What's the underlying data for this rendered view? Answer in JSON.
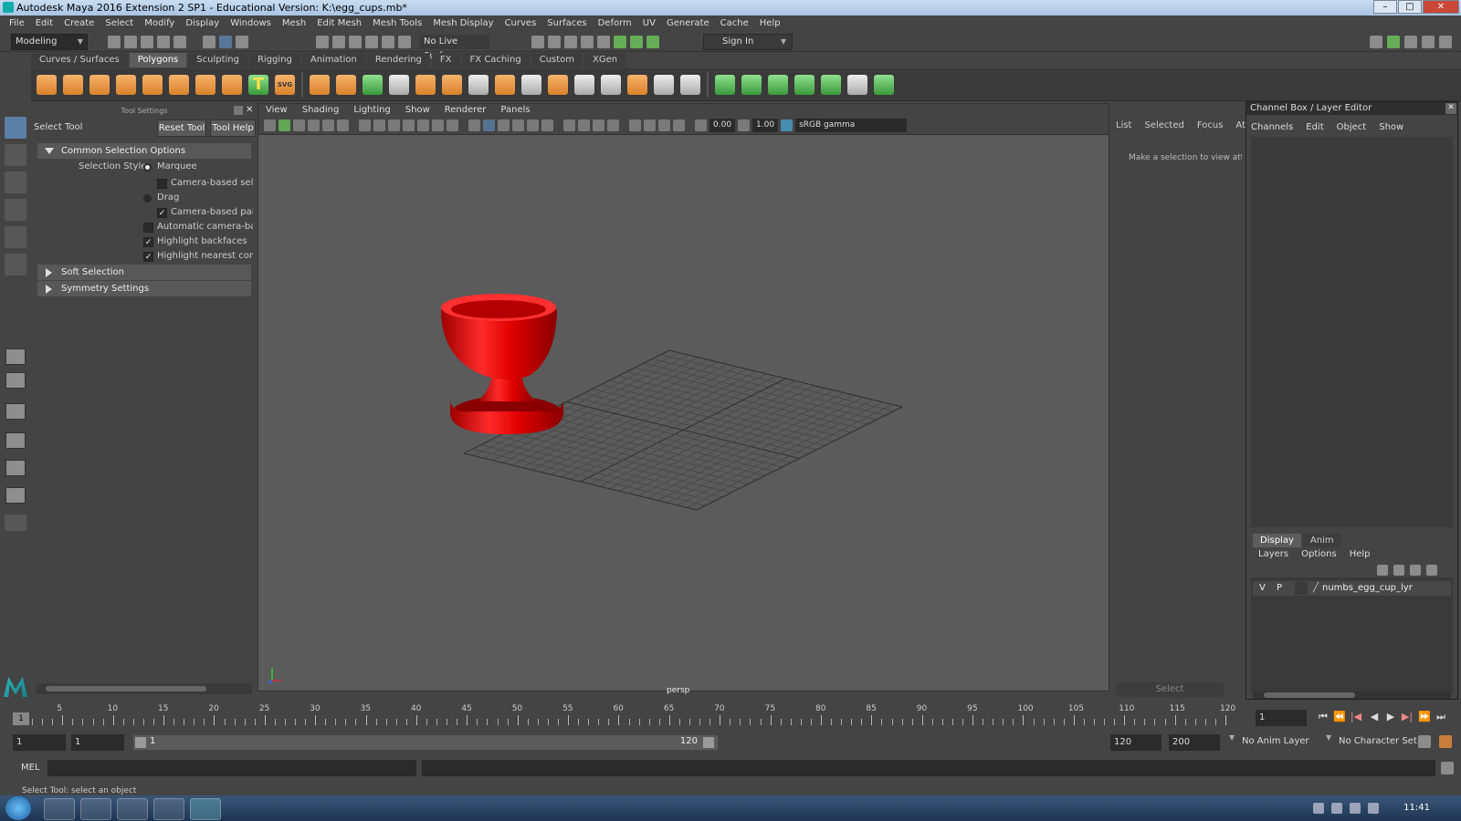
{
  "window": {
    "title": "Autodesk Maya 2016 Extension 2 SP1 - Educational Version: K:\\egg_cups.mb*",
    "min": "–",
    "max": "□",
    "close": "✕"
  },
  "menubar": [
    "File",
    "Edit",
    "Create",
    "Select",
    "Modify",
    "Display",
    "Windows",
    "Mesh",
    "Edit Mesh",
    "Mesh Tools",
    "Mesh Display",
    "Curves",
    "Surfaces",
    "Deform",
    "UV",
    "Generate",
    "Cache",
    "Help"
  ],
  "statusline": {
    "mode": "Modeling",
    "live_surface": "No Live Surface",
    "sign_in": "Sign In"
  },
  "shelf": {
    "tabs": [
      "Curves / Surfaces",
      "Polygons",
      "Sculpting",
      "Rigging",
      "Animation",
      "Rendering",
      "FX",
      "FX Caching",
      "Custom",
      "XGen"
    ],
    "active": "Polygons",
    "text_tool": "T",
    "svg_tool": "SVG"
  },
  "tool_settings": {
    "panel_title": "Tool Settings",
    "tool_name": "Select Tool",
    "reset_tool": "Reset Tool",
    "tool_help": "Tool Help",
    "section_common": "Common Selection Options",
    "selection_style_label": "Selection Style:",
    "marquee": "Marquee",
    "camera_based_selection": "Camera-based selecti",
    "drag": "Drag",
    "camera_based_paint": "Camera-based paint :",
    "automatic_camera_based": "Automatic camera-based",
    "highlight_backfaces": "Highlight backfaces",
    "highlight_nearest": "Highlight nearest compo",
    "section_soft": "Soft Selection",
    "section_symmetry": "Symmetry Settings"
  },
  "viewport": {
    "menus": [
      "View",
      "Shading",
      "Lighting",
      "Show",
      "Renderer",
      "Panels"
    ],
    "exposure": "0.00",
    "gamma": "1.00",
    "color_space": "sRGB gamma",
    "camera_label": "persp"
  },
  "attribute_editor": {
    "tabs": [
      "List",
      "Selected",
      "Focus",
      "Attrib"
    ],
    "message": "Make a selection to view attri",
    "select_button": "Select"
  },
  "channel_box": {
    "title": "Channel Box / Layer Editor",
    "menus": [
      "Channels",
      "Edit",
      "Object",
      "Show"
    ],
    "bottom_tabs": [
      "Display",
      "Anim"
    ],
    "layer_menus": [
      "Layers",
      "Options",
      "Help"
    ],
    "layer": {
      "v": "V",
      "p": "P",
      "name": "numbs_egg_cup_lyr"
    }
  },
  "timeline": {
    "ticks": [
      "5",
      "10",
      "15",
      "20",
      "25",
      "30",
      "35",
      "40",
      "45",
      "50",
      "55",
      "60",
      "65",
      "70",
      "75",
      "80",
      "85",
      "90",
      "95",
      "100",
      "105",
      "110",
      "115",
      "120"
    ],
    "current_frame": "1",
    "current_frame_field": "1",
    "range_start": "1",
    "range_start2": "1",
    "range_slider_start": "1",
    "range_slider_end": "120",
    "end_frame": "120",
    "max_frame": "200",
    "anim_layer": "No Anim Layer",
    "character_set": "No Character Set"
  },
  "command_line": {
    "label": "MEL",
    "help": "Select Tool: select an object"
  },
  "taskbar": {
    "clock": "11:41"
  },
  "colors": {
    "accent": "#5b7fa7",
    "model": "#e00000",
    "viewport_bg": "#5b5b5b"
  }
}
